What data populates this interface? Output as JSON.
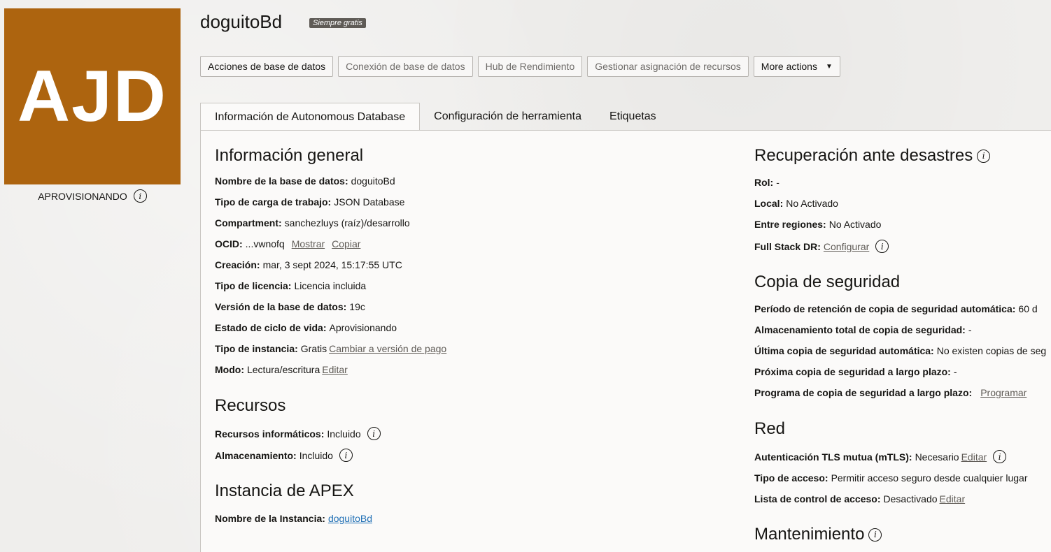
{
  "logo": {
    "text": "AJD",
    "color": "#ad640f"
  },
  "status": {
    "label": "APROVISIONANDO"
  },
  "header": {
    "title": "doguitoBd",
    "badge": "Siempre gratis"
  },
  "toolbar": {
    "buttons": [
      "Acciones de base de datos",
      "Conexión de base de datos",
      "Hub de Rendimiento",
      "Gestionar asignación de recursos",
      "More actions"
    ]
  },
  "tabs": [
    "Información de Autonomous Database",
    "Configuración de herramienta",
    "Etiquetas"
  ],
  "general": {
    "heading": "Información general",
    "db_name": {
      "label": "Nombre de la base de datos:",
      "value": "doguitoBd"
    },
    "workload": {
      "label": "Tipo de carga de trabajo:",
      "value": "JSON Database"
    },
    "compartment": {
      "label": "Compartment:",
      "value": "sanchezluys (raíz)/desarrollo"
    },
    "ocid": {
      "label": "OCID:",
      "value": "...vwnofq",
      "show": "Mostrar",
      "copy": "Copiar"
    },
    "created": {
      "label": "Creación:",
      "value": "mar, 3 sept 2024, 15:17:55 UTC"
    },
    "license": {
      "label": "Tipo de licencia:",
      "value": "Licencia incluida"
    },
    "version": {
      "label": "Versión de la base de datos:",
      "value": "19c"
    },
    "lifecycle": {
      "label": "Estado de ciclo de vida:",
      "value": "Aprovisionando"
    },
    "instance_type": {
      "label": "Tipo de instancia:",
      "value": "Gratis",
      "link": "Cambiar a versión de pago"
    },
    "mode": {
      "label": "Modo:",
      "value": "Lectura/escritura",
      "link": "Editar"
    }
  },
  "resources": {
    "heading": "Recursos",
    "compute": {
      "label": "Recursos informáticos:",
      "value": "Incluido"
    },
    "storage": {
      "label": "Almacenamiento:",
      "value": "Incluido"
    }
  },
  "apex": {
    "heading": "Instancia de APEX",
    "name": {
      "label": "Nombre de la Instancia:",
      "value": "doguitoBd"
    }
  },
  "dr": {
    "heading": "Recuperación ante desastres",
    "role": {
      "label": "Rol:",
      "value": "-"
    },
    "local": {
      "label": "Local:",
      "value": "No Activado"
    },
    "cross": {
      "label": "Entre regiones:",
      "value": "No Activado"
    },
    "fsdr": {
      "label": "Full Stack DR:",
      "link": "Configurar"
    }
  },
  "backup": {
    "heading": "Copia de seguridad",
    "retention": {
      "label": "Período de retención de copia de seguridad automática:",
      "value": "60 d"
    },
    "total": {
      "label": "Almacenamiento total de copia de seguridad:",
      "value": "-"
    },
    "last": {
      "label": "Última copia de seguridad automática:",
      "value": "No existen copias de seg"
    },
    "next": {
      "label": "Próxima copia de seguridad a largo plazo:",
      "value": "-"
    },
    "schedule": {
      "label": "Programa de copia de seguridad a largo plazo:",
      "link": "Programar"
    }
  },
  "network": {
    "heading": "Red",
    "mtls": {
      "label": "Autenticación TLS mutua (mTLS):",
      "value": "Necesario",
      "link": "Editar"
    },
    "access": {
      "label": "Tipo de acceso:",
      "value": "Permitir acceso seguro desde cualquier lugar"
    },
    "acl": {
      "label": "Lista de control de acceso:",
      "value": "Desactivado",
      "link": "Editar"
    }
  },
  "maintenance": {
    "heading": "Mantenimiento"
  },
  "icons": {
    "info": "info-icon",
    "caret": "caret-down-icon"
  }
}
